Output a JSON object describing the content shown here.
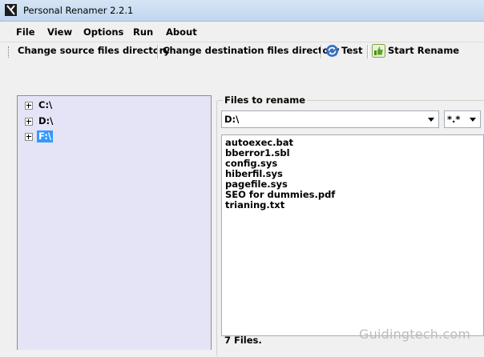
{
  "window": {
    "title": "Personal Renamer 2.2.1"
  },
  "menu": [
    "File",
    "View",
    "Options",
    "Run",
    "About"
  ],
  "toolbar": {
    "change_source": "Change source files directory",
    "change_destination": "Change destination files directory",
    "test": "Test",
    "start_rename": "Start Rename",
    "test_icon": "refresh-icon",
    "start_icon": "thumbs-up-icon"
  },
  "tree": {
    "nodes": [
      {
        "label": "C:\\",
        "selected": false
      },
      {
        "label": "D:\\",
        "selected": false
      },
      {
        "label": "F:\\",
        "selected": true
      }
    ]
  },
  "files_panel": {
    "title": "Files to rename",
    "directory_value": "D:\\",
    "filter_value": "*.*",
    "files": [
      "autoexec.bat",
      "bberror1.sbl",
      "config.sys",
      "hiberfil.sys",
      "pagefile.sys",
      "SEO for dummies.pdf",
      "trianing.txt"
    ],
    "status": "7 Files."
  },
  "watermark": "Guidingtech.com",
  "colors": {
    "tree_background": "#e4e4f6",
    "selection": "#3399ff",
    "title_bar": "#c1d6ee"
  }
}
